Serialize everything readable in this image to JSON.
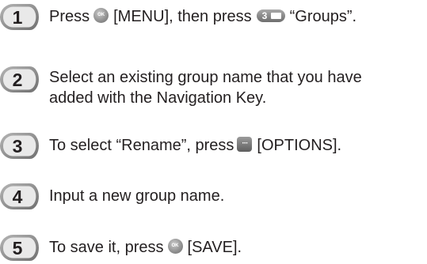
{
  "steps": [
    {
      "number": "1",
      "press": "Press",
      "menu": "[MENU], then press",
      "groups": "“Groups”.",
      "ok_key_label": "OK",
      "key3_digit": "3",
      "icons": [
        "ok-key-icon",
        "key-3-def-icon"
      ]
    },
    {
      "number": "2",
      "line1": "Select an existing group name that you have",
      "line2": "added with the Navigation Key."
    },
    {
      "number": "3",
      "before": "To select “Rename”, press",
      "after": "[OPTIONS].",
      "options_key_label": "···",
      "icons": [
        "options-key-icon"
      ]
    },
    {
      "number": "4",
      "text": "Input a new group name."
    },
    {
      "number": "5",
      "before": "To save it, press",
      "after": "[SAVE].",
      "ok_key_label": "OK",
      "icons": [
        "ok-key-icon"
      ]
    }
  ],
  "colors": {
    "text": "#231f20",
    "badge_outer": "#8c8c8c",
    "badge_inner": "#e6e6e6",
    "key": "#8a8a8a"
  }
}
